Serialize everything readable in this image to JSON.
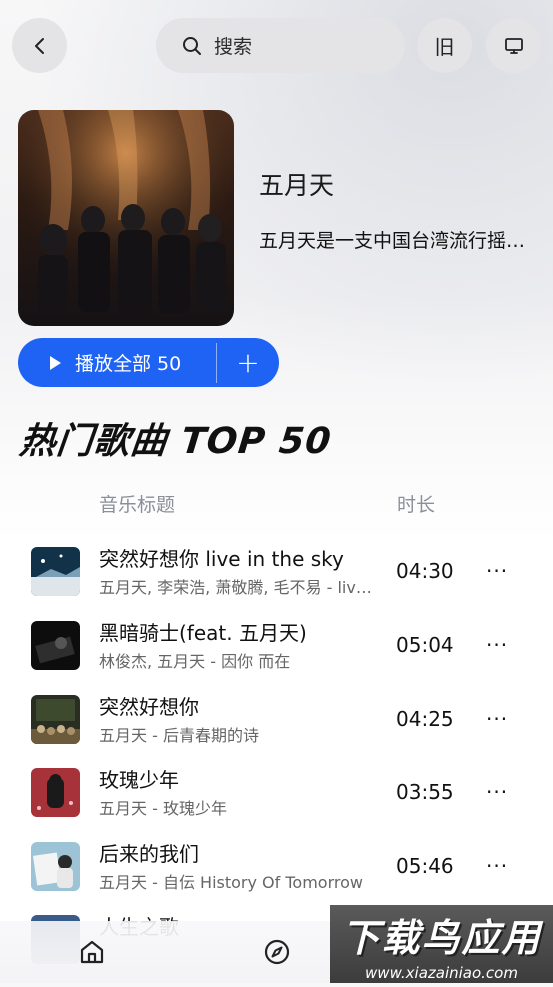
{
  "header": {
    "search_placeholder": "搜索",
    "old_label": "旧"
  },
  "artist": {
    "name": "五月天",
    "description": "五月天是一支中国台湾流行摇滚乐团"
  },
  "actions": {
    "play_all_label": "播放全部 50",
    "add_label": "+"
  },
  "section": {
    "title": "热门歌曲 TOP 50",
    "col_title": "音乐标题",
    "col_duration": "时长"
  },
  "songs": [
    {
      "title": "突然好想你 live in the sky",
      "subtitle": "五月天, 李荣浩, 萧敬腾, 毛不易 - live in the sky",
      "duration": "04:30",
      "more": "···"
    },
    {
      "title": "黑暗骑士(feat. 五月天)",
      "subtitle": "林俊杰, 五月天 - 因你 而在",
      "duration": "05:04",
      "more": "···"
    },
    {
      "title": "突然好想你",
      "subtitle": "五月天 - 后青春期的诗",
      "duration": "04:25",
      "more": "···"
    },
    {
      "title": "玫瑰少年",
      "subtitle": "五月天 - 玫瑰少年",
      "duration": "03:55",
      "more": "···"
    },
    {
      "title": "后来的我们",
      "subtitle": "五月天 - 自伝 History Of Tomorrow",
      "duration": "05:46",
      "more": "···"
    },
    {
      "title": "人生之歌",
      "subtitle": "",
      "duration": "",
      "more": ""
    }
  ],
  "watermark": {
    "main": "下载鸟应用",
    "url": "www.xiazainiao.com"
  }
}
